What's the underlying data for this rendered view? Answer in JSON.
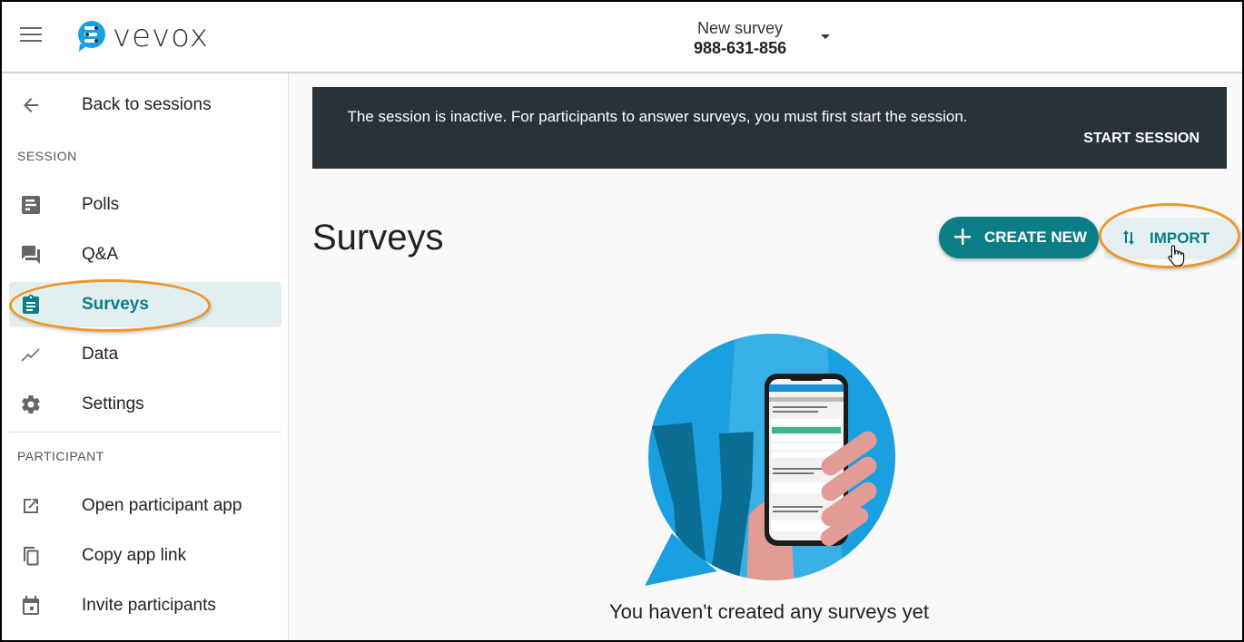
{
  "header": {
    "menu_icon": "hamburger-menu-icon",
    "logo_text": "vevox",
    "session_name": "New survey",
    "session_code": "988-631-856"
  },
  "sidebar": {
    "back": {
      "label": "Back to sessions",
      "icon": "arrow-left-icon"
    },
    "session_section": "SESSION",
    "session_items": [
      {
        "label": "Polls",
        "icon": "poll-icon",
        "active": false
      },
      {
        "label": "Q&A",
        "icon": "forum-icon",
        "active": false
      },
      {
        "label": "Surveys",
        "icon": "clipboard-icon",
        "active": true
      },
      {
        "label": "Data",
        "icon": "trending-line-icon",
        "active": false
      },
      {
        "label": "Settings",
        "icon": "gear-icon",
        "active": false
      }
    ],
    "participant_section": "PARTICIPANT",
    "participant_items": [
      {
        "label": "Open participant app",
        "icon": "open-external-icon"
      },
      {
        "label": "Copy app link",
        "icon": "copy-icon"
      },
      {
        "label": "Invite participants",
        "icon": "calendar-icon"
      }
    ]
  },
  "banner": {
    "message": "The session is inactive. For participants to answer surveys, you must first start the session.",
    "action_label": "START SESSION"
  },
  "main": {
    "title": "Surveys",
    "create_label": "CREATE NEW",
    "import_label": "IMPORT",
    "empty_message": "You haven't created any surveys yet"
  },
  "colors": {
    "brand_teal": "#0b7d85",
    "banner_bg": "#283339",
    "highlight_orange": "#f0962a",
    "active_bg": "#e2eff0",
    "logo_blue": "#1aa0e0"
  }
}
